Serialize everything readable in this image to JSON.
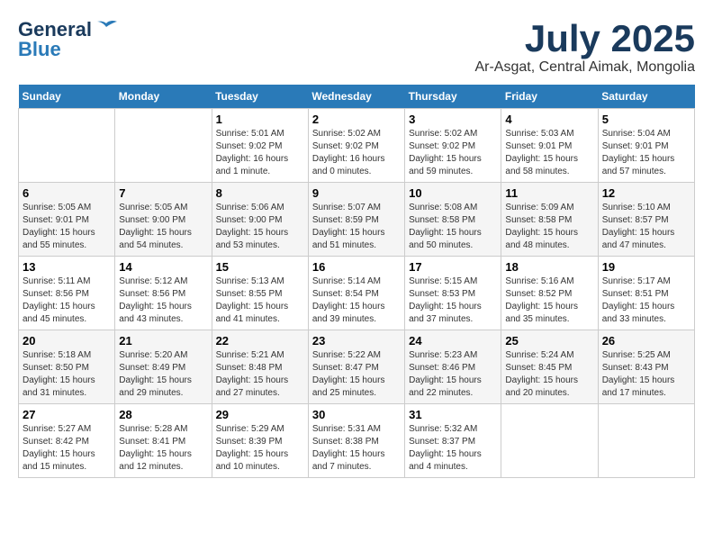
{
  "header": {
    "logo_general": "General",
    "logo_blue": "Blue",
    "month": "July 2025",
    "location": "Ar-Asgat, Central Aimak, Mongolia"
  },
  "weekdays": [
    "Sunday",
    "Monday",
    "Tuesday",
    "Wednesday",
    "Thursday",
    "Friday",
    "Saturday"
  ],
  "weeks": [
    [
      {
        "day": "",
        "sunrise": "",
        "sunset": "",
        "daylight": ""
      },
      {
        "day": "",
        "sunrise": "",
        "sunset": "",
        "daylight": ""
      },
      {
        "day": "1",
        "sunrise": "Sunrise: 5:01 AM",
        "sunset": "Sunset: 9:02 PM",
        "daylight": "Daylight: 16 hours and 1 minute."
      },
      {
        "day": "2",
        "sunrise": "Sunrise: 5:02 AM",
        "sunset": "Sunset: 9:02 PM",
        "daylight": "Daylight: 16 hours and 0 minutes."
      },
      {
        "day": "3",
        "sunrise": "Sunrise: 5:02 AM",
        "sunset": "Sunset: 9:02 PM",
        "daylight": "Daylight: 15 hours and 59 minutes."
      },
      {
        "day": "4",
        "sunrise": "Sunrise: 5:03 AM",
        "sunset": "Sunset: 9:01 PM",
        "daylight": "Daylight: 15 hours and 58 minutes."
      },
      {
        "day": "5",
        "sunrise": "Sunrise: 5:04 AM",
        "sunset": "Sunset: 9:01 PM",
        "daylight": "Daylight: 15 hours and 57 minutes."
      }
    ],
    [
      {
        "day": "6",
        "sunrise": "Sunrise: 5:05 AM",
        "sunset": "Sunset: 9:01 PM",
        "daylight": "Daylight: 15 hours and 55 minutes."
      },
      {
        "day": "7",
        "sunrise": "Sunrise: 5:05 AM",
        "sunset": "Sunset: 9:00 PM",
        "daylight": "Daylight: 15 hours and 54 minutes."
      },
      {
        "day": "8",
        "sunrise": "Sunrise: 5:06 AM",
        "sunset": "Sunset: 9:00 PM",
        "daylight": "Daylight: 15 hours and 53 minutes."
      },
      {
        "day": "9",
        "sunrise": "Sunrise: 5:07 AM",
        "sunset": "Sunset: 8:59 PM",
        "daylight": "Daylight: 15 hours and 51 minutes."
      },
      {
        "day": "10",
        "sunrise": "Sunrise: 5:08 AM",
        "sunset": "Sunset: 8:58 PM",
        "daylight": "Daylight: 15 hours and 50 minutes."
      },
      {
        "day": "11",
        "sunrise": "Sunrise: 5:09 AM",
        "sunset": "Sunset: 8:58 PM",
        "daylight": "Daylight: 15 hours and 48 minutes."
      },
      {
        "day": "12",
        "sunrise": "Sunrise: 5:10 AM",
        "sunset": "Sunset: 8:57 PM",
        "daylight": "Daylight: 15 hours and 47 minutes."
      }
    ],
    [
      {
        "day": "13",
        "sunrise": "Sunrise: 5:11 AM",
        "sunset": "Sunset: 8:56 PM",
        "daylight": "Daylight: 15 hours and 45 minutes."
      },
      {
        "day": "14",
        "sunrise": "Sunrise: 5:12 AM",
        "sunset": "Sunset: 8:56 PM",
        "daylight": "Daylight: 15 hours and 43 minutes."
      },
      {
        "day": "15",
        "sunrise": "Sunrise: 5:13 AM",
        "sunset": "Sunset: 8:55 PM",
        "daylight": "Daylight: 15 hours and 41 minutes."
      },
      {
        "day": "16",
        "sunrise": "Sunrise: 5:14 AM",
        "sunset": "Sunset: 8:54 PM",
        "daylight": "Daylight: 15 hours and 39 minutes."
      },
      {
        "day": "17",
        "sunrise": "Sunrise: 5:15 AM",
        "sunset": "Sunset: 8:53 PM",
        "daylight": "Daylight: 15 hours and 37 minutes."
      },
      {
        "day": "18",
        "sunrise": "Sunrise: 5:16 AM",
        "sunset": "Sunset: 8:52 PM",
        "daylight": "Daylight: 15 hours and 35 minutes."
      },
      {
        "day": "19",
        "sunrise": "Sunrise: 5:17 AM",
        "sunset": "Sunset: 8:51 PM",
        "daylight": "Daylight: 15 hours and 33 minutes."
      }
    ],
    [
      {
        "day": "20",
        "sunrise": "Sunrise: 5:18 AM",
        "sunset": "Sunset: 8:50 PM",
        "daylight": "Daylight: 15 hours and 31 minutes."
      },
      {
        "day": "21",
        "sunrise": "Sunrise: 5:20 AM",
        "sunset": "Sunset: 8:49 PM",
        "daylight": "Daylight: 15 hours and 29 minutes."
      },
      {
        "day": "22",
        "sunrise": "Sunrise: 5:21 AM",
        "sunset": "Sunset: 8:48 PM",
        "daylight": "Daylight: 15 hours and 27 minutes."
      },
      {
        "day": "23",
        "sunrise": "Sunrise: 5:22 AM",
        "sunset": "Sunset: 8:47 PM",
        "daylight": "Daylight: 15 hours and 25 minutes."
      },
      {
        "day": "24",
        "sunrise": "Sunrise: 5:23 AM",
        "sunset": "Sunset: 8:46 PM",
        "daylight": "Daylight: 15 hours and 22 minutes."
      },
      {
        "day": "25",
        "sunrise": "Sunrise: 5:24 AM",
        "sunset": "Sunset: 8:45 PM",
        "daylight": "Daylight: 15 hours and 20 minutes."
      },
      {
        "day": "26",
        "sunrise": "Sunrise: 5:25 AM",
        "sunset": "Sunset: 8:43 PM",
        "daylight": "Daylight: 15 hours and 17 minutes."
      }
    ],
    [
      {
        "day": "27",
        "sunrise": "Sunrise: 5:27 AM",
        "sunset": "Sunset: 8:42 PM",
        "daylight": "Daylight: 15 hours and 15 minutes."
      },
      {
        "day": "28",
        "sunrise": "Sunrise: 5:28 AM",
        "sunset": "Sunset: 8:41 PM",
        "daylight": "Daylight: 15 hours and 12 minutes."
      },
      {
        "day": "29",
        "sunrise": "Sunrise: 5:29 AM",
        "sunset": "Sunset: 8:39 PM",
        "daylight": "Daylight: 15 hours and 10 minutes."
      },
      {
        "day": "30",
        "sunrise": "Sunrise: 5:31 AM",
        "sunset": "Sunset: 8:38 PM",
        "daylight": "Daylight: 15 hours and 7 minutes."
      },
      {
        "day": "31",
        "sunrise": "Sunrise: 5:32 AM",
        "sunset": "Sunset: 8:37 PM",
        "daylight": "Daylight: 15 hours and 4 minutes."
      },
      {
        "day": "",
        "sunrise": "",
        "sunset": "",
        "daylight": ""
      },
      {
        "day": "",
        "sunrise": "",
        "sunset": "",
        "daylight": ""
      }
    ]
  ]
}
